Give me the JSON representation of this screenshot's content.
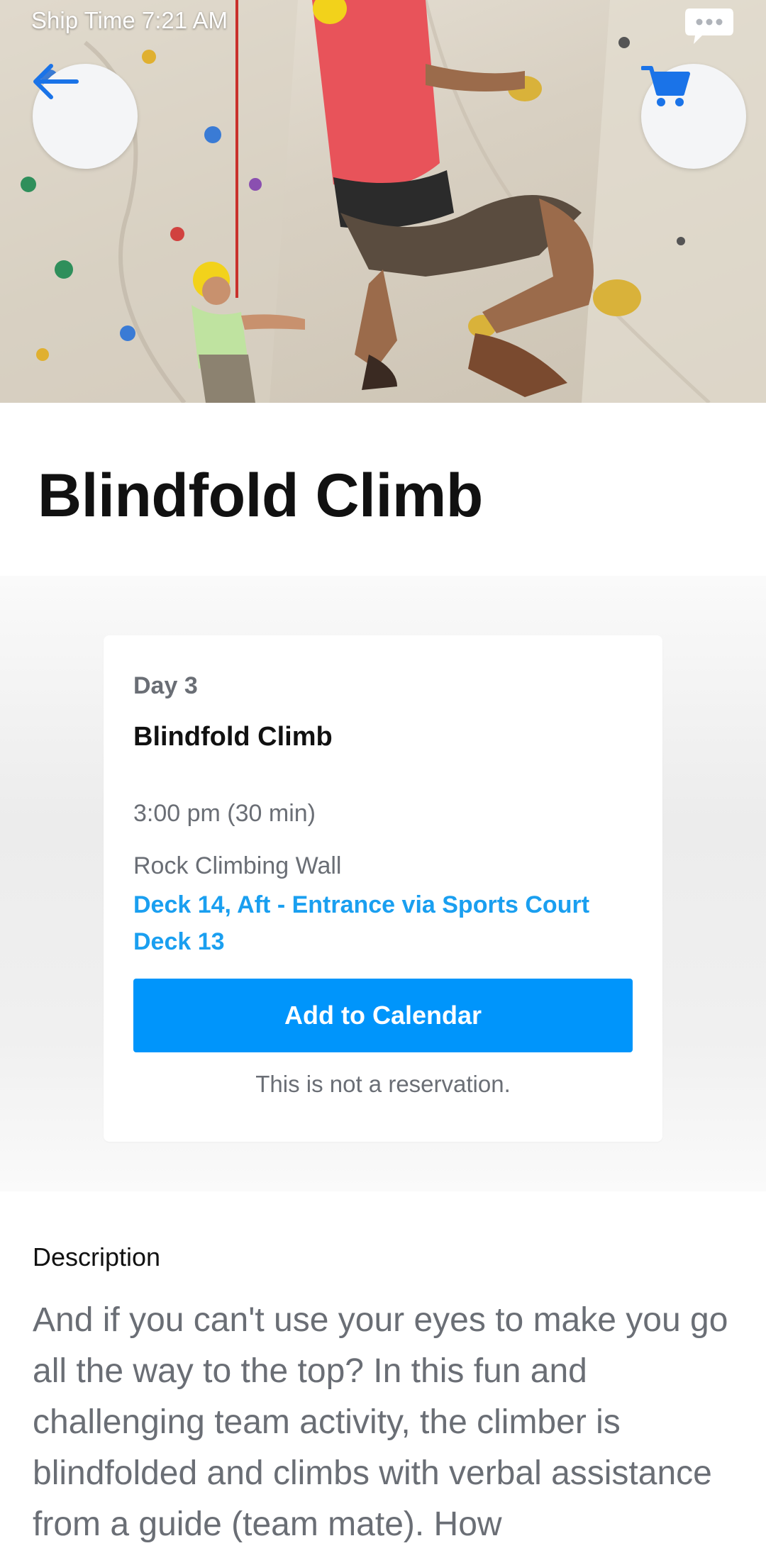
{
  "status_bar": {
    "label": "Ship Time",
    "time": "7:21 AM"
  },
  "hero": {
    "image_subject": "rock-climbing-wall-photo"
  },
  "icons": {
    "back": "arrow-left-icon",
    "cart": "cart-icon",
    "chat": "chat-bubble-icon"
  },
  "title": "Blindfold Climb",
  "event_card": {
    "day": "Day 3",
    "title": "Blindfold Climb",
    "time": "3:00 pm (30 min)",
    "venue": "Rock Climbing Wall",
    "location": "Deck 14, Aft - Entrance via Sports Court Deck 13",
    "button_label": "Add to Calendar",
    "note": "This is not a reservation."
  },
  "description": {
    "label": "Description",
    "text": "And if you can't use your eyes to make you go all the way to the top? In this fun and challenging team activity, the climber is blindfolded and climbs with verbal assistance from a guide (team mate). How"
  },
  "colors": {
    "accent": "#0095fb",
    "link": "#1a9ff0",
    "muted_text": "#6a6e75",
    "icon_blue": "#1a73e8"
  }
}
